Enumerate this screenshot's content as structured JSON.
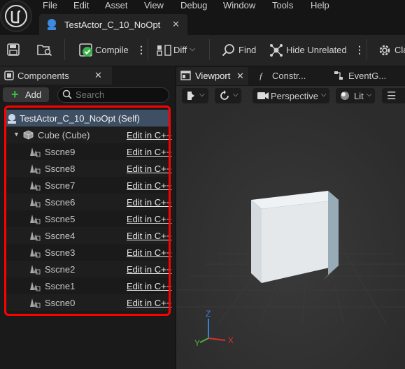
{
  "menu": [
    "File",
    "Edit",
    "Asset",
    "View",
    "Debug",
    "Window",
    "Tools",
    "Help"
  ],
  "document_tab": {
    "title": "TestActor_C_10_NoOpt",
    "close": "✕"
  },
  "toolbar": {
    "compile_label": "Compile",
    "diff_label": "Diff",
    "find_label": "Find",
    "hide_unrelated_label": "Hide Unrelated",
    "class_label_partial": "Cla"
  },
  "components_panel": {
    "title": "Components",
    "close": "✕",
    "add_label": "Add",
    "search_placeholder": "Search",
    "root": {
      "label": "TestActor_C_10_NoOpt (Self)"
    },
    "cube": {
      "label": "Cube (Cube)",
      "edit_label": "Edit in C++"
    },
    "children": [
      {
        "label": "Sscne9",
        "edit_label": "Edit in C++"
      },
      {
        "label": "Sscne8",
        "edit_label": "Edit in C++"
      },
      {
        "label": "Sscne7",
        "edit_label": "Edit in C++"
      },
      {
        "label": "Sscne6",
        "edit_label": "Edit in C++"
      },
      {
        "label": "Sscne5",
        "edit_label": "Edit in C++"
      },
      {
        "label": "Sscne4",
        "edit_label": "Edit in C++"
      },
      {
        "label": "Sscne3",
        "edit_label": "Edit in C++"
      },
      {
        "label": "Sscne2",
        "edit_label": "Edit in C++"
      },
      {
        "label": "Sscne1",
        "edit_label": "Edit in C++"
      },
      {
        "label": "Sscne0",
        "edit_label": "Edit in C++"
      }
    ]
  },
  "viewport_tabs": {
    "viewport_label": "Viewport",
    "viewport_close": "✕",
    "construction_label": "Constr...",
    "event_graph_label": "EventG..."
  },
  "viewport_toolbar": {
    "perspective_label": "Perspective",
    "lit_label": "Lit"
  },
  "axes": {
    "z": "Z",
    "y": "Y",
    "x": "X"
  },
  "colors": {
    "highlight": "#ff0000",
    "selected_row": "#3f4f63",
    "axis_x": "#d9302f",
    "axis_y": "#4fb23a",
    "axis_z": "#3a7fd6",
    "compile_ok": "#39b54a"
  }
}
